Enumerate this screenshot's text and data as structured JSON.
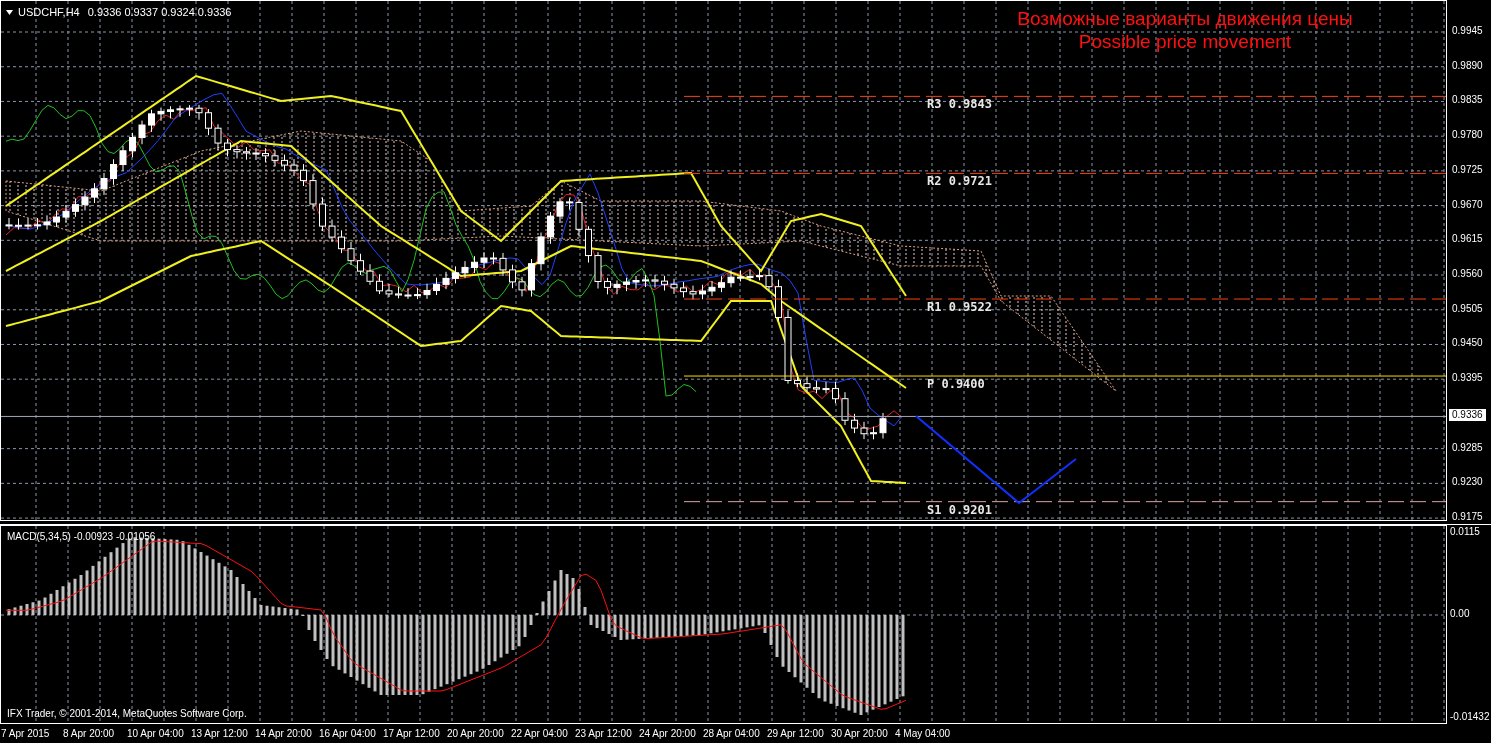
{
  "symbol_header": {
    "symbol": "USDCHF,H4",
    "ohlc": "0.9336 0.9337 0.9324 0.9336"
  },
  "forecast_title": [
    "Возможные варианты движения цены",
    "Possible price movement"
  ],
  "levels": [
    {
      "label": "R3",
      "price": "0.9843",
      "kind": "resistance"
    },
    {
      "label": "R2",
      "price": "0.9721",
      "kind": "resistance"
    },
    {
      "label": "R1",
      "price": "0.9522",
      "kind": "resistance"
    },
    {
      "label": "P",
      "price": "0.9400",
      "kind": "pivot"
    },
    {
      "label": "S1",
      "price": "0.9201",
      "kind": "support"
    }
  ],
  "price_axis": [
    "0.9945",
    "0.9890",
    "0.9835",
    "0.9780",
    "0.9725",
    "0.9670",
    "0.9615",
    "0.9560",
    "0.9505",
    "0.9450",
    "0.9395",
    "0.9285",
    "0.9230",
    "0.9175"
  ],
  "current_price": "0.9336",
  "indicator": {
    "label": "MACD(5,34,5) -0.00923 -0.01056",
    "axis": [
      "0.0115",
      "0.00",
      "-0.01432"
    ]
  },
  "copyright": "IFX Trader, © 2001-2014, MetaQuotes Software Corp.",
  "time_axis": [
    "7 Apr 2015",
    "8 Apr 20:00",
    "10 Apr 04:00",
    "13 Apr 12:00",
    "14 Apr 20:00",
    "16 Apr 04:00",
    "17 Apr 12:00",
    "20 Apr 20:00",
    "22 Apr 04:00",
    "23 Apr 12:00",
    "24 Apr 20:00",
    "28 Apr 04:00",
    "29 Apr 12:00",
    "30 Apr 20:00",
    "4 May 04:00"
  ]
}
